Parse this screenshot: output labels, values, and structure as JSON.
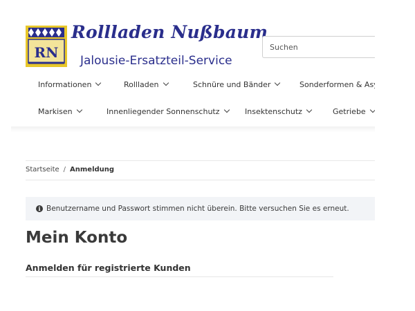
{
  "header": {
    "logo_letters": "RN",
    "brand_title": "Rollladen Nußbaum",
    "brand_subtitle": "Jalousie-Ersatzteil-Service",
    "search_placeholder": "Suchen"
  },
  "nav": {
    "row1": [
      "Informationen",
      "Rollladen",
      "Schnüre und Bänder",
      "Sonderformen & Asym"
    ],
    "row2": [
      "Markisen",
      "Innenliegender Sonnenschutz",
      "Insektenschutz",
      "Getriebe"
    ]
  },
  "breadcrumb": {
    "home": "Startseite",
    "separator": "/",
    "current": "Anmeldung"
  },
  "alert": {
    "message": "Benutzername und Passwort stimmen nicht überein. Bitte versuchen Sie es erneut."
  },
  "main": {
    "page_title": "Mein Konto",
    "section_title": "Anmelden für registrierte Kunden"
  },
  "colors": {
    "brand": "#2a2e8c",
    "logo_gold": "#e8c72a",
    "alert_bg": "#f2f4f7"
  }
}
